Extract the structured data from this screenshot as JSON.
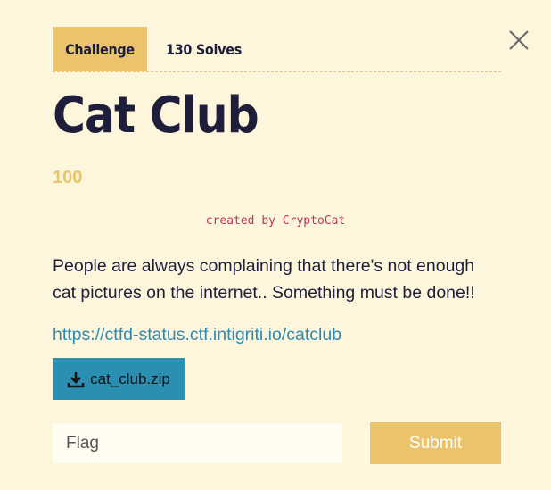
{
  "tabs": [
    {
      "label": "Challenge"
    },
    {
      "label": "130 Solves"
    }
  ],
  "challenge": {
    "title": "Cat Club",
    "points": "100",
    "created_by": "created by CryptoCat",
    "description": "People are always complaining that there's not enough cat pictures on the internet.. Something must be done!!",
    "link": "https://ctfd-status.ctf.intigriti.io/catclub",
    "download_label": "cat_club.zip"
  },
  "form": {
    "flag_placeholder": "Flag",
    "flag_value": "",
    "submit_label": "Submit"
  },
  "icons": {
    "close": "close-icon",
    "download": "download-icon"
  },
  "colors": {
    "background": "#fdf6dd",
    "accent": "#ebc36a",
    "link": "#2d8bb3",
    "download_button": "#2a8fb1",
    "author": "#c0335a"
  }
}
